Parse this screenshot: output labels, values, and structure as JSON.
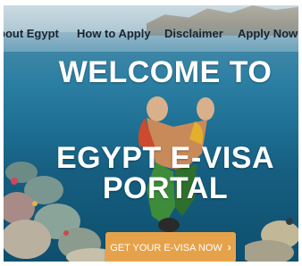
{
  "nav": {
    "items": [
      {
        "label": "bout Egypt"
      },
      {
        "label": "How to Apply"
      },
      {
        "label": "Disclaimer"
      },
      {
        "label": "Apply Now"
      }
    ]
  },
  "hero": {
    "title_line1": "WELCOME TO",
    "title_line2": "EGYPT E-VISA",
    "title_line3": "PORTAL",
    "cta_label": "GET YOUR E-VISA NOW",
    "cta_icon": "chevron-right-icon"
  },
  "colors": {
    "cta_background": "#e6a24a",
    "title_text": "#ffffff",
    "nav_text": "#1c2530"
  }
}
